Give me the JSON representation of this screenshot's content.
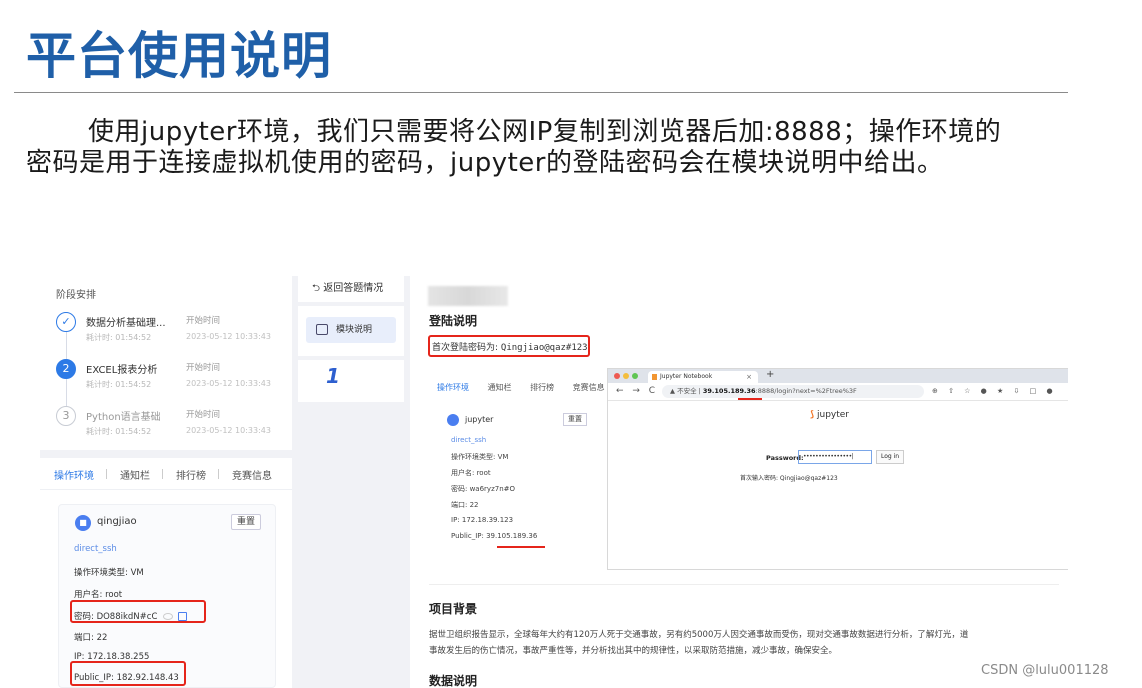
{
  "slide": {
    "title": "平台使用说明",
    "intro": "使用jupyter环境，我们只需要将公网IP复制到浏览器后加:8888；操作环境的密码是用于连接虚拟机使用的密码，jupyter的登陆密码会在模块说明中给出。"
  },
  "stages": {
    "title": "阶段安排",
    "items": [
      {
        "index": "✓",
        "name": "数据分析基础理...",
        "elapsed": "耗计时: 01:54:52",
        "start_label": "开始时间",
        "start_date": "2023-05-12 10:33:43"
      },
      {
        "index": "2",
        "name": "EXCEL报表分析",
        "elapsed": "耗计时: 01:54:52",
        "start_label": "开始时间",
        "start_date": "2023-05-12 10:33:43"
      },
      {
        "index": "3",
        "name": "Python语言基础",
        "elapsed": "耗计时: 01:54:52",
        "start_label": "开始时间",
        "start_date": "2023-05-12 10:33:43"
      }
    ]
  },
  "env": {
    "tabs": [
      "操作环境",
      "通知栏",
      "排行榜",
      "竞赛信息"
    ],
    "vm_name": "qingjiao",
    "reset_label": "重置",
    "link": "direct_ssh",
    "type_row": "操作环境类型: VM",
    "user_row": "用户名: root",
    "pw_row": "密码: DO88ikdN#cC",
    "port_row": "端口: 22",
    "ip_row": "IP: 172.18.38.255",
    "public_ip_row": "Public_IP: 182.92.148.43"
  },
  "middle": {
    "back_label": "返回答题情况",
    "module_label": "模块说明",
    "number": "1"
  },
  "content": {
    "login_title": "登陆说明",
    "first_pw_label": "首次登陆密码为: ",
    "first_pw_value": "Qingjiao@qaz#123",
    "inner": {
      "tabs": [
        "操作环境",
        "通知栏",
        "排行榜",
        "竞赛信息"
      ],
      "vm_name": "jupyter",
      "reset_label": "重置",
      "link": "direct_ssh",
      "type_row": "操作环境类型: VM",
      "user_row": "用户名: root",
      "pw_row": "密码: wa6ryz7n#O",
      "port_row": "端口: 22",
      "ip_row": "IP: 172.18.39.123",
      "public_ip_label": "Public_IP: ",
      "public_ip_value": "39.105.189.36"
    },
    "browser": {
      "tab_title": "Jupyter Notebook",
      "tab_close": "×",
      "new_tab": "+",
      "nav": "← → C",
      "url_prefix": "▲ 不安全 | ",
      "url_host": "39.105.189.36",
      "url_rest": ":8888/login?next=%2Ftree%3F",
      "ext_icons": "⊕ ⇧ ☆ ● ★ ⇩ □ ●",
      "logo_mark": "⟆",
      "logo_text": "jupyter",
      "pw_label": "Password:",
      "pw_value": "••••••••••••••••|",
      "login_btn": "Log in",
      "hint": "首次输入密码: Qingjiao@qaz#123"
    },
    "bg_title": "项目背景",
    "bg_line1": "据世卫组织报告显示，全球每年大约有120万人死于交通事故，另有约5000万人因交通事故而受伤，现对交通事故数据进行分析，了解灯光，道",
    "bg_line2": "事故发生后的伤亡情况，事故严重性等，并分析找出其中的规律性，以采取防范措施，减少事故，确保安全。",
    "data_title": "数据说明"
  },
  "watermark": "CSDN @lulu001128",
  "colors": {
    "accent": "#2d7ae6",
    "title_blue": "#1f5fa8",
    "highlight_red": "#e5251b"
  }
}
